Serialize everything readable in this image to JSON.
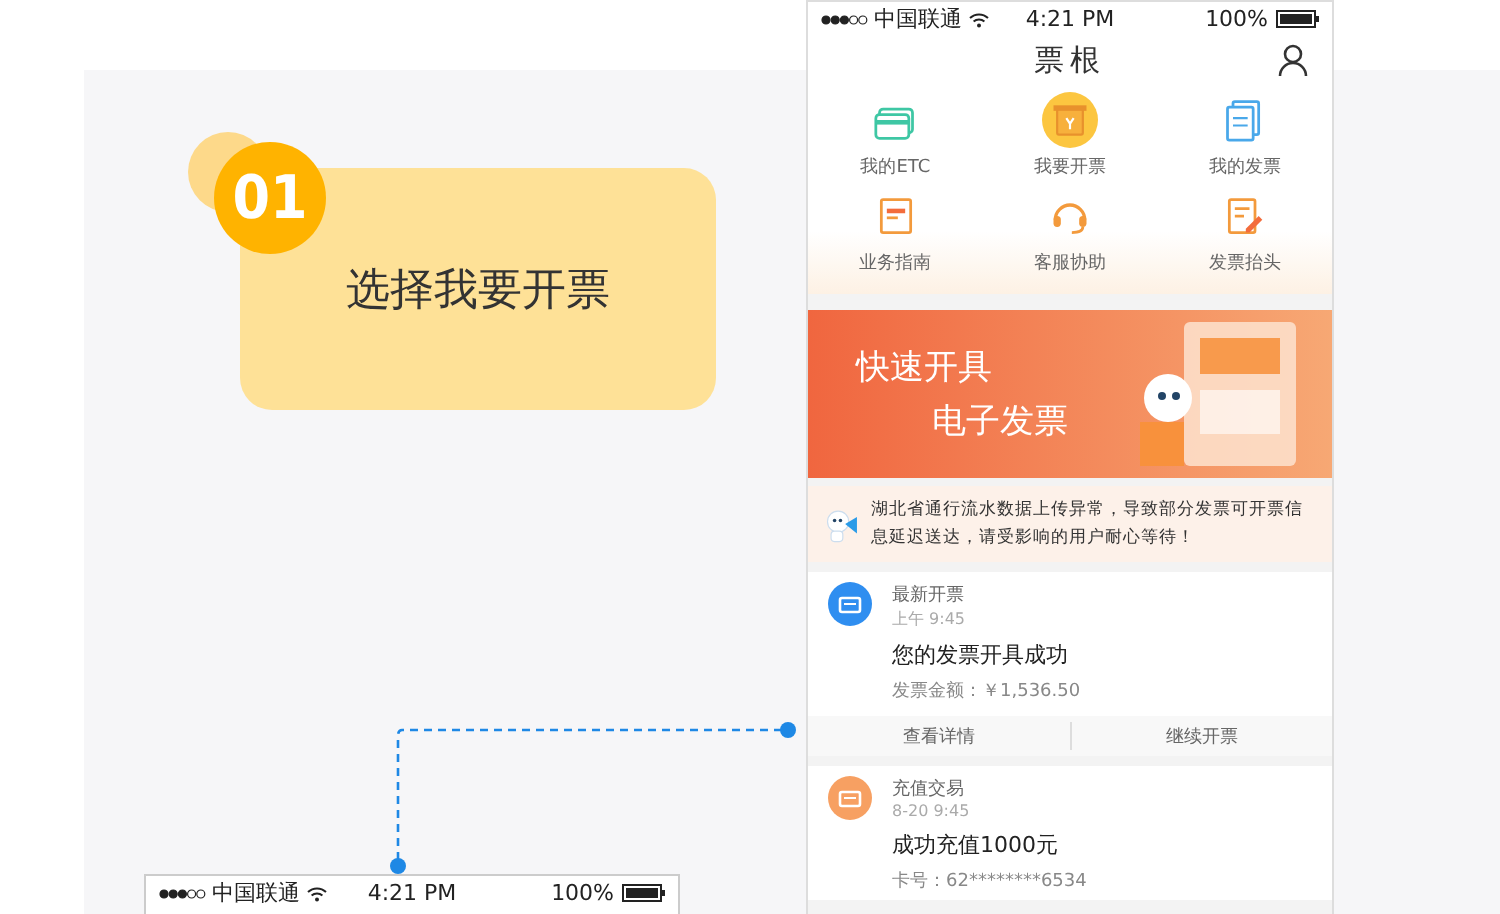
{
  "step": {
    "number": "01",
    "label": "选择我要开票"
  },
  "phone": {
    "status_bar": {
      "carrier": "中国联通",
      "time": "4:21 PM",
      "battery": "100%"
    },
    "title": "票根",
    "tiles": [
      {
        "label": "我的ETC",
        "selected": false
      },
      {
        "label": "我要开票",
        "selected": true
      },
      {
        "label": "我的发票",
        "selected": false
      },
      {
        "label": "业务指南",
        "selected": false
      },
      {
        "label": "客服协助",
        "selected": false
      },
      {
        "label": "发票抬头",
        "selected": false
      }
    ],
    "banner": {
      "line_1": "快速开具",
      "line_2": "电子发票"
    },
    "notice": "湖北省通行流水数据上传异常，导致部分发票可开票信息延迟送达，请受影响的用户耐心等待！",
    "cards": [
      {
        "category": "最新开票",
        "time": "上午 9:45",
        "title": "您的发票开具成功",
        "detail": "发票金额：￥1,536.50",
        "color": "#2f8ef0",
        "actions": [
          "查看详情",
          "继续开票"
        ]
      },
      {
        "category": "充值交易",
        "time": "8-20 9:45",
        "title": "成功充值1000元",
        "detail": "卡号：62********6534",
        "color": "#f7a062"
      }
    ]
  },
  "second_phone": {
    "status_bar": {
      "carrier": "中国联通",
      "time": "4:21 PM",
      "battery": "100%"
    }
  }
}
